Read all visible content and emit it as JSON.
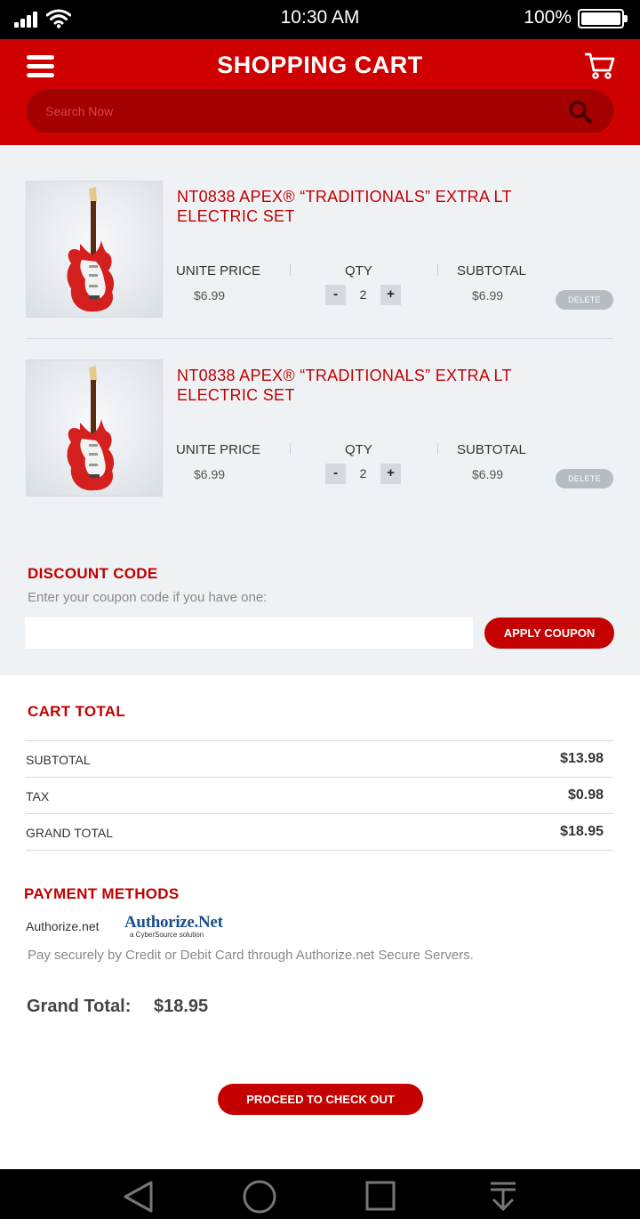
{
  "status_bar": {
    "time": "10:30 AM",
    "battery": "100%"
  },
  "header": {
    "title": "SHOPPING CART",
    "search_placeholder": "Search Now"
  },
  "cart": {
    "items": [
      {
        "name": "NT0838 APEX® “TRADITIONALS” EXTRA LT ELECTRIC SET",
        "unit_price_label": "UNITE PRICE",
        "unit_price": "$6.99",
        "qty_label": "QTY",
        "qty": "2",
        "minus": "-",
        "plus": "+",
        "subtotal_label": "SUBTOTAL",
        "subtotal": "$6.99",
        "delete_label": "DELETE"
      },
      {
        "name": "NT0838 APEX® “TRADITIONALS” EXTRA LT ELECTRIC SET",
        "unit_price_label": "UNITE PRICE",
        "unit_price": "$6.99",
        "qty_label": "QTY",
        "qty": "2",
        "minus": "-",
        "plus": "+",
        "subtotal_label": "SUBTOTAL",
        "subtotal": "$6.99",
        "delete_label": "DELETE"
      }
    ]
  },
  "discount": {
    "title": "DISCOUNT CODE",
    "hint": "Enter your coupon code if you have one:",
    "input_value": "",
    "apply_label": "APPLY COUPON"
  },
  "totals": {
    "title": "CART TOTAL",
    "rows": [
      {
        "label": "SUBTOTAL",
        "value": "$13.98"
      },
      {
        "label": "TAX",
        "value": "$0.98"
      },
      {
        "label": "GRAND TOTAL",
        "value": "$18.95"
      }
    ]
  },
  "payment": {
    "title": "PAYMENT METHODS",
    "method_name": "Authorize.net",
    "logo_text": "Authorize.Net",
    "logo_subtext": "a CyberSource solution",
    "description": "Pay securely by Credit or Debit Card through Authorize.net Secure Servers."
  },
  "summary": {
    "grand_total_label": "Grand Total:",
    "grand_total_value": "$18.95"
  },
  "checkout": {
    "label": "PROCEED TO CHECK OUT"
  },
  "colors": {
    "brand_red": "#cf0000",
    "button_red": "#c40000",
    "cart_bg": "#eff2f5"
  }
}
